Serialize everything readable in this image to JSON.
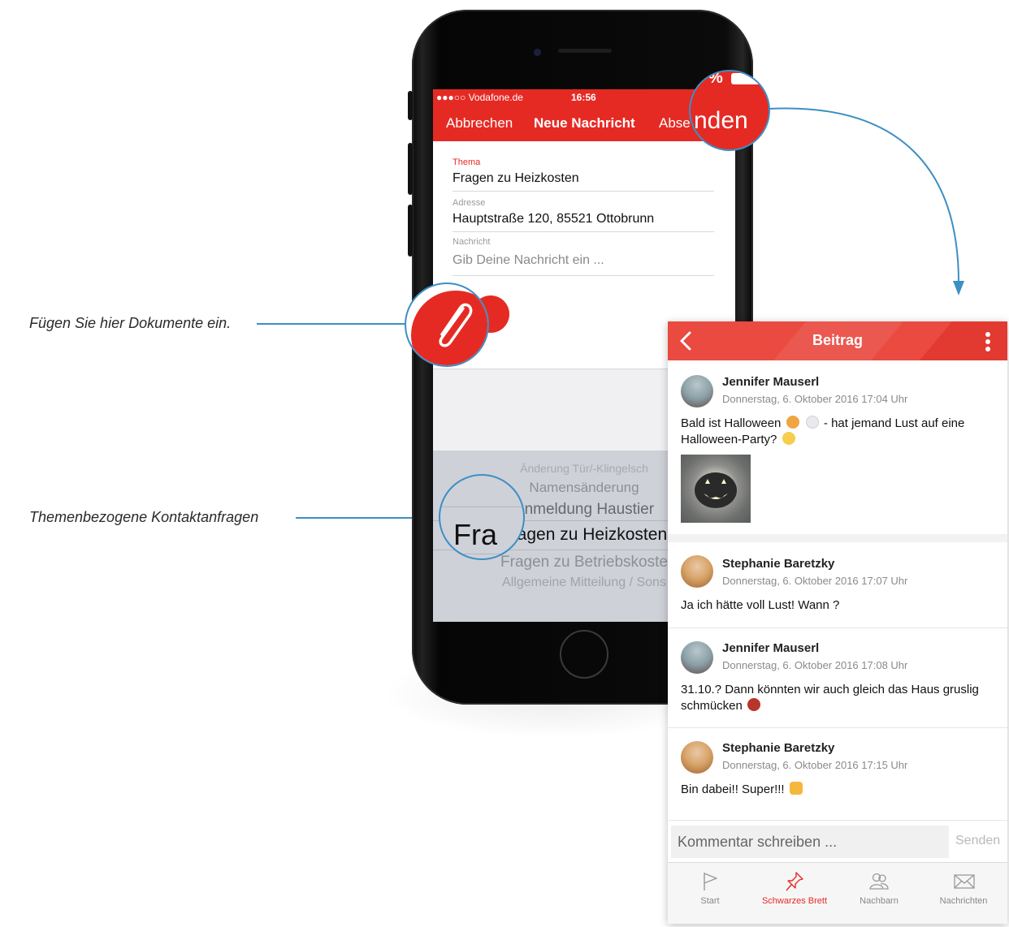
{
  "callouts": {
    "documents": "Fügen Sie hier Dokumente ein.",
    "topics": "Themenbezogene Kontaktanfragen"
  },
  "compose": {
    "status": {
      "carrier": "●●●○○ Vodafone.de",
      "time": "16:56",
      "battery_fragment": "% "
    },
    "nav": {
      "cancel": "Abbrechen",
      "title": "Neue Nachricht",
      "send_partial": "Abse",
      "send_zoom": "nden"
    },
    "fields": {
      "topic_label": "Thema",
      "topic_value": "Fragen zu Heizkosten",
      "address_label": "Adresse",
      "address_value": "Hauptstraße 120, 85521 Ottobrunn",
      "message_label": "Nachricht",
      "message_placeholder": "Gib Deine Nachricht ein ..."
    },
    "picker": {
      "items": [
        "Änderung Tür/-Klingelsch",
        "Namensänderung",
        "Anmeldung Haustier",
        "Fragen zu Heizkosten",
        "Fragen zu Betriebskoste",
        "Allgemeine Mitteilung / Sons"
      ],
      "zoom_text": "Fra"
    }
  },
  "panel": {
    "title": "Beitrag",
    "posts": [
      {
        "author": "Jennifer Mauserl",
        "date": "Donnerstag, 6. Oktober 2016 17:04 Uhr",
        "text_a": "Bald ist Halloween",
        "text_b": "- hat jemand Lust auf eine Halloween-Party?"
      },
      {
        "author": "Stephanie Baretzky",
        "date": "Donnerstag, 6. Oktober 2016 17:07 Uhr",
        "text": "Ja ich hätte voll Lust! Wann ?"
      },
      {
        "author": "Jennifer Mauserl",
        "date": "Donnerstag, 6. Oktober 2016 17:08 Uhr",
        "text": "31.10.? Dann könnten wir auch gleich das Haus gruslig schmücken"
      },
      {
        "author": "Stephanie Baretzky",
        "date": "Donnerstag, 6. Oktober 2016 17:15 Uhr",
        "text": "Bin dabei!! Super!!!"
      }
    ],
    "comment_placeholder": "Kommentar schreiben ...",
    "comment_send": "Senden",
    "tabs": [
      {
        "label": "Start",
        "icon": "flag-icon"
      },
      {
        "label": "Schwarzes Brett",
        "icon": "pin-icon",
        "active": true
      },
      {
        "label": "Nachbarn",
        "icon": "neighbors-icon"
      },
      {
        "label": "Nachrichten",
        "icon": "envelope-icon"
      }
    ],
    "colors": {
      "accent": "#e52a24",
      "callout": "#3d8fc4"
    }
  }
}
